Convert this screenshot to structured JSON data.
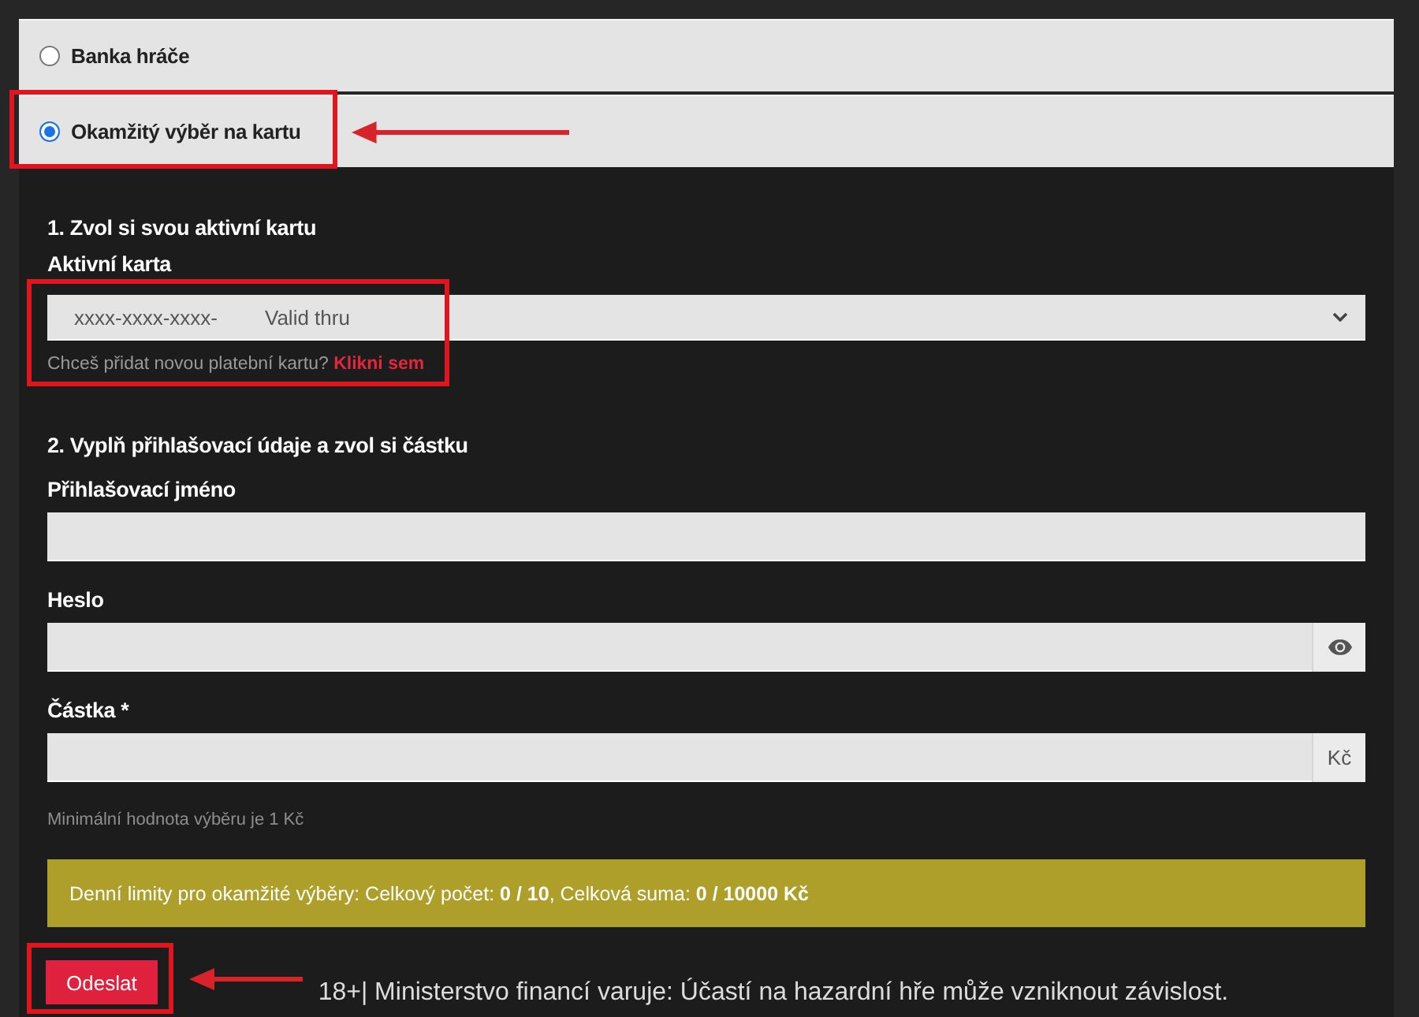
{
  "payout_methods": [
    {
      "label": "Banka hráče",
      "selected": false,
      "highlighted": false,
      "arrow": false
    },
    {
      "label": "Okamžitý výběr na kartu",
      "selected": true,
      "highlighted": true,
      "arrow": true
    }
  ],
  "card_section": {
    "heading": "1. Zvol si svou aktivní kartu",
    "label": "Aktivní karta",
    "select": {
      "card_number": "xxxx-xxxx-xxxx-",
      "expiry_label": "Valid thru"
    },
    "hint": "Chceš přidat novou platební kartu?",
    "link": "Klikni sem",
    "highlighted": true
  },
  "login_section": {
    "heading": "2. Vyplň přihlašovací údaje a zvol si částku",
    "fields": [
      {
        "label": "Přihlašovací jméno",
        "kind": "text"
      },
      {
        "label": "Heslo",
        "kind": "password"
      },
      {
        "label": "Částka *",
        "kind": "amount",
        "addon": "Kč"
      }
    ],
    "hint": "Minimální hodnota výběru je 1 Kč"
  },
  "limits_notice": "Denní limity pro okamžité výběry: Celkový počet: **0 / 10**, Celková suma: **0 / 10000 Kč**",
  "submit": {
    "label": "Odeslat",
    "highlighted": true,
    "arrow": true
  },
  "warning": "18+| Ministerstvo financí varuje: Účastí na hazardní hře může vzniknout závislost."
}
